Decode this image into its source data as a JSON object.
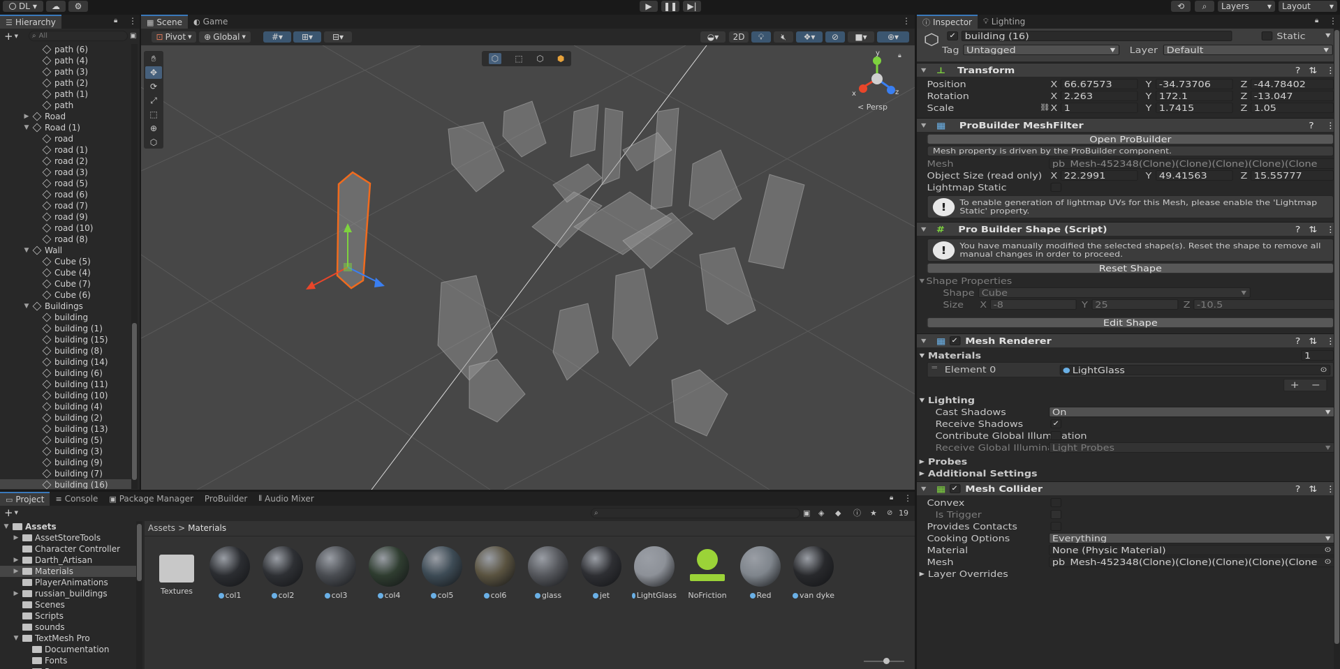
{
  "toolbar": {
    "account": "DL",
    "layers": "Layers",
    "layout": "Layout"
  },
  "hierarchy": {
    "tab": "Hierarchy",
    "search_placeholder": "All",
    "items": [
      {
        "label": "path (6)",
        "depth": 2
      },
      {
        "label": "path (4)",
        "depth": 2
      },
      {
        "label": "path (3)",
        "depth": 2
      },
      {
        "label": "path (2)",
        "depth": 2
      },
      {
        "label": "path (1)",
        "depth": 2
      },
      {
        "label": "path",
        "depth": 2
      },
      {
        "label": "Road",
        "depth": 1,
        "arrow": "▶"
      },
      {
        "label": "Road (1)",
        "depth": 1,
        "arrow": "▼"
      },
      {
        "label": "road",
        "depth": 2
      },
      {
        "label": "road (1)",
        "depth": 2
      },
      {
        "label": "road (2)",
        "depth": 2
      },
      {
        "label": "road (3)",
        "depth": 2
      },
      {
        "label": "road (5)",
        "depth": 2
      },
      {
        "label": "road (6)",
        "depth": 2
      },
      {
        "label": "road (7)",
        "depth": 2
      },
      {
        "label": "road (9)",
        "depth": 2
      },
      {
        "label": "road (10)",
        "depth": 2
      },
      {
        "label": "road (8)",
        "depth": 2
      },
      {
        "label": "Wall",
        "depth": 1,
        "arrow": "▼"
      },
      {
        "label": "Cube (5)",
        "depth": 2
      },
      {
        "label": "Cube (4)",
        "depth": 2
      },
      {
        "label": "Cube (7)",
        "depth": 2
      },
      {
        "label": "Cube (6)",
        "depth": 2
      },
      {
        "label": "Buildings",
        "depth": 1,
        "arrow": "▼"
      },
      {
        "label": "building",
        "depth": 2
      },
      {
        "label": "building (1)",
        "depth": 2
      },
      {
        "label": "building (15)",
        "depth": 2
      },
      {
        "label": "building (8)",
        "depth": 2
      },
      {
        "label": "building (14)",
        "depth": 2
      },
      {
        "label": "building (6)",
        "depth": 2
      },
      {
        "label": "building (11)",
        "depth": 2
      },
      {
        "label": "building (10)",
        "depth": 2
      },
      {
        "label": "building (4)",
        "depth": 2
      },
      {
        "label": "building (2)",
        "depth": 2
      },
      {
        "label": "building (13)",
        "depth": 2
      },
      {
        "label": "building (5)",
        "depth": 2
      },
      {
        "label": "building (3)",
        "depth": 2
      },
      {
        "label": "building (9)",
        "depth": 2
      },
      {
        "label": "building (7)",
        "depth": 2
      },
      {
        "label": "building (16)",
        "depth": 2,
        "selected": true
      }
    ]
  },
  "scene": {
    "tabs": [
      "Scene",
      "Game"
    ],
    "pivot": "Pivot",
    "global": "Global",
    "mode_2d": "2D",
    "persp": "< Persp",
    "gizmo_y": "y",
    "gizmo_x": "x",
    "gizmo_z": "z"
  },
  "inspector": {
    "tabs": [
      "Inspector",
      "Lighting"
    ],
    "object_name": "building (16)",
    "static_label": "Static",
    "tag_label": "Tag",
    "tag_value": "Untagged",
    "layer_label": "Layer",
    "layer_value": "Default",
    "transform": {
      "title": "Transform",
      "rows": [
        {
          "label": "Position",
          "x": "66.67573",
          "y": "-34.73706",
          "z": "-44.78402"
        },
        {
          "label": "Rotation",
          "x": "2.263",
          "y": "172.1",
          "z": "-13.047"
        },
        {
          "label": "Scale",
          "x": "1",
          "y": "1.7415",
          "z": "1.05"
        }
      ]
    },
    "meshfilter": {
      "title": "ProBuilder MeshFilter",
      "open_button": "Open ProBuilder",
      "note": "Mesh property is driven by the ProBuilder component.",
      "mesh_label": "Mesh",
      "mesh_value": "pb_Mesh-452348(Clone)(Clone)(Clone)(Clone)(Clone",
      "size_label": "Object Size (read only)",
      "size_x": "22.2991",
      "size_y": "49.41563",
      "size_z": "15.55777",
      "lightmap_label": "Lightmap Static",
      "warning": "To enable generation of lightmap UVs for this Mesh, please enable the 'Lightmap Static' property."
    },
    "shape": {
      "title": "Pro Builder Shape (Script)",
      "warning": "You have manually modified the selected shape(s). Reset the shape to remove all manual changes in order to proceed.",
      "reset_button": "Reset Shape",
      "props_label": "Shape Properties",
      "shape_label": "Shape",
      "shape_value": "Cube",
      "size_label": "Size",
      "size_x": "-8",
      "size_y": "25",
      "size_z": "-10.5",
      "edit_button": "Edit Shape"
    },
    "renderer": {
      "title": "Mesh Renderer",
      "materials_label": "Materials",
      "materials_count": "1",
      "element_label": "Element 0",
      "element_value": "LightGlass",
      "lighting_label": "Lighting",
      "cast_label": "Cast Shadows",
      "cast_value": "On",
      "receive_label": "Receive Shadows",
      "contribute_label": "Contribute Global Illumination",
      "receive_gi_label": "Receive Global Illumination",
      "receive_gi_value": "Light Probes",
      "probes_label": "Probes",
      "additional_label": "Additional Settings"
    },
    "collider": {
      "title": "Mesh Collider",
      "convex_label": "Convex",
      "trigger_label": "Is Trigger",
      "contacts_label": "Provides Contacts",
      "cooking_label": "Cooking Options",
      "cooking_value": "Everything",
      "material_label": "Material",
      "material_value": "None (Physic Material)",
      "mesh_label": "Mesh",
      "mesh_value": "pb_Mesh-452348(Clone)(Clone)(Clone)(Clone)(Clone",
      "overrides_label": "Layer Overrides"
    }
  },
  "project": {
    "tabs": [
      "Project",
      "Console",
      "Package Manager",
      "ProBuilder",
      "Audio Mixer"
    ],
    "hidden_count": "19",
    "breadcrumb_root": "Assets",
    "breadcrumb_leaf": "Materials",
    "tree": [
      {
        "label": "Assets",
        "depth": 0,
        "arrow": "▼",
        "bold": true
      },
      {
        "label": "AssetStoreTools",
        "depth": 1,
        "arrow": "▶"
      },
      {
        "label": "Character Controller",
        "depth": 1,
        "arrow": ""
      },
      {
        "label": "Darth_Artisan",
        "depth": 1,
        "arrow": "▶"
      },
      {
        "label": "Materials",
        "depth": 1,
        "arrow": "▶",
        "selected": true
      },
      {
        "label": "PlayerAnimations",
        "depth": 1,
        "arrow": ""
      },
      {
        "label": "russian_buildings",
        "depth": 1,
        "arrow": "▶"
      },
      {
        "label": "Scenes",
        "depth": 1,
        "arrow": ""
      },
      {
        "label": "Scripts",
        "depth": 1,
        "arrow": ""
      },
      {
        "label": "sounds",
        "depth": 1,
        "arrow": ""
      },
      {
        "label": "TextMesh Pro",
        "depth": 1,
        "arrow": "▼"
      },
      {
        "label": "Documentation",
        "depth": 2,
        "arrow": ""
      },
      {
        "label": "Fonts",
        "depth": 2,
        "arrow": ""
      },
      {
        "label": "Resources",
        "depth": 2,
        "arrow": ""
      }
    ],
    "assets": [
      {
        "label": "Textures",
        "kind": "folder"
      },
      {
        "label": "col1",
        "kind": "sphere",
        "color": "#2b2d31"
      },
      {
        "label": "col2",
        "kind": "sphere",
        "color": "#2e3034"
      },
      {
        "label": "col3",
        "kind": "sphere",
        "color": "#4a4d52"
      },
      {
        "label": "col4",
        "kind": "sphere",
        "color": "#2f3d30"
      },
      {
        "label": "col5",
        "kind": "sphere",
        "color": "#3d4b55"
      },
      {
        "label": "col6",
        "kind": "sphere",
        "color": "#5a5340"
      },
      {
        "label": "glass",
        "kind": "sphere",
        "color": "#55575c"
      },
      {
        "label": "jet",
        "kind": "sphere",
        "color": "#2e2f33"
      },
      {
        "label": "LightGlass",
        "kind": "sphere",
        "color": "#8d9198"
      },
      {
        "label": "NoFriction",
        "kind": "physic"
      },
      {
        "label": "Red",
        "kind": "sphere",
        "color": "#7f858c"
      },
      {
        "label": "van dyke",
        "kind": "sphere",
        "color": "#28292c"
      }
    ]
  }
}
